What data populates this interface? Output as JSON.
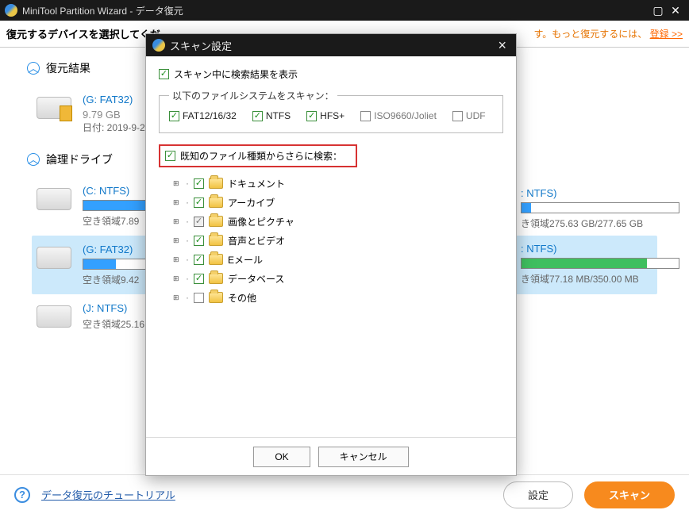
{
  "window": {
    "title": "MiniTool Partition Wizard - データ復元",
    "maximize_title": "Maximize",
    "close_title": "Close"
  },
  "topbar": {
    "prompt": "復元するデバイスを選択してくだ",
    "promo_suffix": "す。もっと復元するには、",
    "register": "登録 >>"
  },
  "sections": {
    "recovery_results": "復元結果",
    "logical_drives": "論理ドライブ"
  },
  "result_device": {
    "name": "(G: FAT32)",
    "size": "9.79 GB",
    "date": "日付: 2019-9-2"
  },
  "drives": [
    {
      "name": "(C: NTFS)",
      "meta": "空き領域7.89",
      "fill": 92,
      "selected": false,
      "style": "blue"
    },
    {
      "name": "(G: FAT32)",
      "meta": "空き領域9.42",
      "fill": 8,
      "selected": true,
      "style": "blue"
    },
    {
      "name": "(J: NTFS)",
      "meta": "空き領域25.16",
      "fill": 0,
      "selected": false,
      "style": "none"
    }
  ],
  "right_drives": [
    {
      "name": ": NTFS)",
      "meta": "き領域275.63 GB/277.65 GB",
      "fill": 6,
      "style": "blue"
    },
    {
      "name": ": NTFS)",
      "meta": "き領域77.18 MB/350.00 MB",
      "fill": 80,
      "style": "green"
    }
  ],
  "bottom": {
    "tutorial": "データ復元のチュートリアル",
    "settings": "設定",
    "scan": "スキャン"
  },
  "dialog": {
    "title": "スキャン設定",
    "show_results_while_scan": "スキャン中に検索結果を表示",
    "fs_legend": "以下のファイルシステムをスキャン：",
    "fs": {
      "fat": {
        "label": "FAT12/16/32",
        "checked": true
      },
      "ntfs": {
        "label": "NTFS",
        "checked": true
      },
      "hfs": {
        "label": "HFS+",
        "checked": true
      },
      "iso": {
        "label": "ISO9660/Joliet",
        "checked": false
      },
      "udf": {
        "label": "UDF",
        "checked": false
      }
    },
    "extra_search_label": "既知のファイル種類からさらに検索：",
    "tree": [
      {
        "label": "ドキュメント",
        "checked": true,
        "expandable": true
      },
      {
        "label": "アーカイブ",
        "checked": true,
        "expandable": true
      },
      {
        "label": "画像とピクチャ",
        "checked": true,
        "expandable": true,
        "dim": true
      },
      {
        "label": "音声とビデオ",
        "checked": true,
        "expandable": true
      },
      {
        "label": "Eメール",
        "checked": true,
        "expandable": true
      },
      {
        "label": "データベース",
        "checked": true,
        "expandable": true
      },
      {
        "label": "その他",
        "checked": false,
        "expandable": true
      }
    ],
    "ok": "OK",
    "cancel": "キャンセル"
  }
}
